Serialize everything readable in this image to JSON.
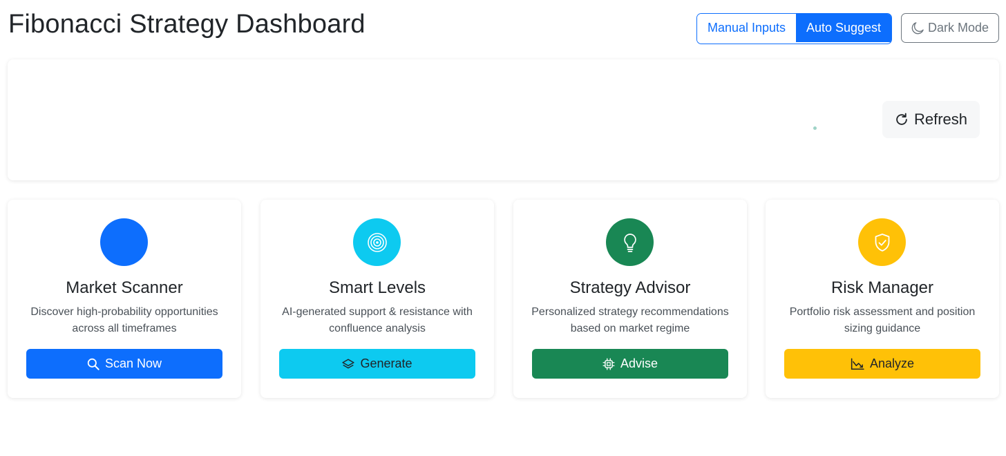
{
  "header": {
    "title": "Fibonacci Strategy Dashboard",
    "mode_manual": "Manual Inputs",
    "mode_auto": "Auto Suggest",
    "dark_mode": "Dark Mode"
  },
  "panel": {
    "refresh_label": "Refresh"
  },
  "cards": [
    {
      "title": "Market Scanner",
      "description": "Discover high-probability opportunities across all timeframes",
      "button": "Scan Now",
      "color": "#0d6efd",
      "icon": "search-icon"
    },
    {
      "title": "Smart Levels",
      "description": "AI-generated support & resistance with confluence analysis",
      "button": "Generate",
      "color": "#0dcaf0",
      "icon": "layers-icon"
    },
    {
      "title": "Strategy Advisor",
      "description": "Personalized strategy recommendations based on market regime",
      "button": "Advise",
      "color": "#198754",
      "icon": "cpu-icon"
    },
    {
      "title": "Risk Manager",
      "description": "Portfolio risk assessment and position sizing guidance",
      "button": "Analyze",
      "color": "#ffc107",
      "icon": "graph-down-icon"
    }
  ]
}
